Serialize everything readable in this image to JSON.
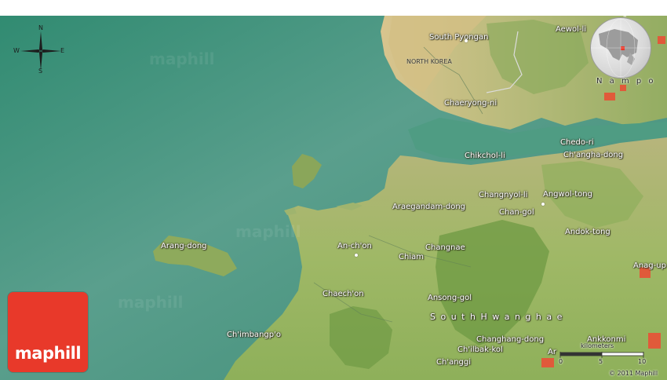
{
  "watermark": "maphill",
  "logo": {
    "text": "maphill",
    "color": "#e8392a"
  },
  "compass": {
    "north": "N",
    "south": "S",
    "east": "E",
    "west": "W"
  },
  "inset_label": "N a m p o",
  "country_label": "NORTH KOREA",
  "regions": {
    "south_pyongan": "South Pyongan",
    "south_hwanghae": "S o u t h  H w a n g h a e"
  },
  "places": {
    "aewol_li": "Aewol-li",
    "chaeryong_ni": "Chaeryong-ni",
    "chikchol_li": "Chikchol-li",
    "chedo_ri": "Chedo-ri",
    "changha_dong": "Ch'angha-dong",
    "changnyol_li": "Changnyol-li",
    "angwol_tong": "Angwol-tong",
    "araegandam_dong": "Araegandam-dong",
    "chan_gol": "Chan-gol",
    "andok_tong": "Andok-tong",
    "arang_dong": "Arang-dong",
    "an_chon": "An-ch'on",
    "chiam": "Chiam",
    "changnae": "Changnae",
    "anag_up": "Anag-up",
    "chaechon": "Chaech'on",
    "ansong_gol": "Ansong-gol",
    "chimbangpo": "Ch'imbangp'o",
    "changhang_dong": "Changhang-dong",
    "chilbak_kol": "Ch'ilbak-kol",
    "changgi": "Ch'anggi",
    "ankkonmi": "Ankkonmi",
    "ar": "Ar"
  },
  "scale": {
    "unit": "kilometers",
    "ticks": [
      "0",
      "5",
      "10"
    ]
  },
  "copyright": "© 2011 Maphill",
  "colors": {
    "sea_dark": "#3e8f76",
    "sea_light": "#6fae9c",
    "land": "#a3b96a",
    "land_green": "#7fa34c",
    "shore": "#c9b582",
    "city": "#e05a3a"
  }
}
